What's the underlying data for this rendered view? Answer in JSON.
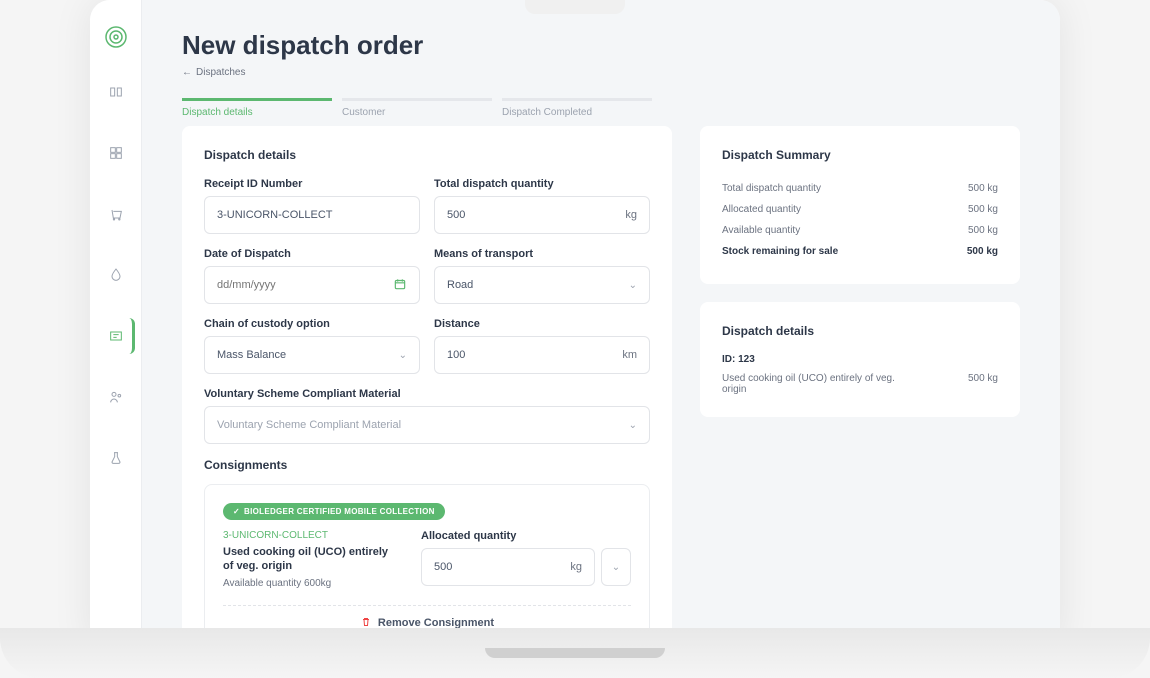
{
  "header": {
    "title": "New dispatch order",
    "breadcrumb": "Dispatches"
  },
  "tabs": [
    {
      "label": "Dispatch details",
      "active": true
    },
    {
      "label": "Customer",
      "active": false
    },
    {
      "label": "Dispatch Completed",
      "active": false
    }
  ],
  "form": {
    "section_title": "Dispatch details",
    "receipt_id": {
      "label": "Receipt ID Number",
      "value": "3-UNICORN-COLLECT"
    },
    "total_qty": {
      "label": "Total dispatch quantity",
      "value": "500",
      "unit": "kg"
    },
    "date": {
      "label": "Date of Dispatch",
      "placeholder": "dd/mm/yyyy"
    },
    "transport": {
      "label": "Means of transport",
      "value": "Road"
    },
    "custody": {
      "label": "Chain of custody option",
      "value": "Mass Balance"
    },
    "distance": {
      "label": "Distance",
      "value": "100",
      "unit": "km"
    },
    "scheme": {
      "label": "Voluntary Scheme Compliant Material",
      "placeholder": "Voluntary Scheme Compliant Material"
    }
  },
  "consignments": {
    "title": "Consignments",
    "badge": "BIOLEDGER CERTIFIED MOBILE COLLECTION",
    "id": "3-UNICORN-COLLECT",
    "name": "Used cooking oil (UCO) entirely of veg. origin",
    "available": "Available quantity 600kg",
    "alloc_label": "Allocated quantity",
    "alloc_value": "500",
    "alloc_unit": "kg",
    "remove": "Remove Consignment"
  },
  "summary": {
    "title": "Dispatch Summary",
    "rows": [
      {
        "label": "Total dispatch quantity",
        "value": "500 kg"
      },
      {
        "label": "Allocated quantity",
        "value": "500 kg"
      },
      {
        "label": "Available quantity",
        "value": "500 kg"
      },
      {
        "label": "Stock remaining for sale",
        "value": "500 kg",
        "strong": true
      }
    ]
  },
  "details_panel": {
    "title": "Dispatch details",
    "id_label": "ID: 123",
    "item_label": "Used cooking oil (UCO) entirely of veg. origin",
    "item_value": "500 kg"
  }
}
